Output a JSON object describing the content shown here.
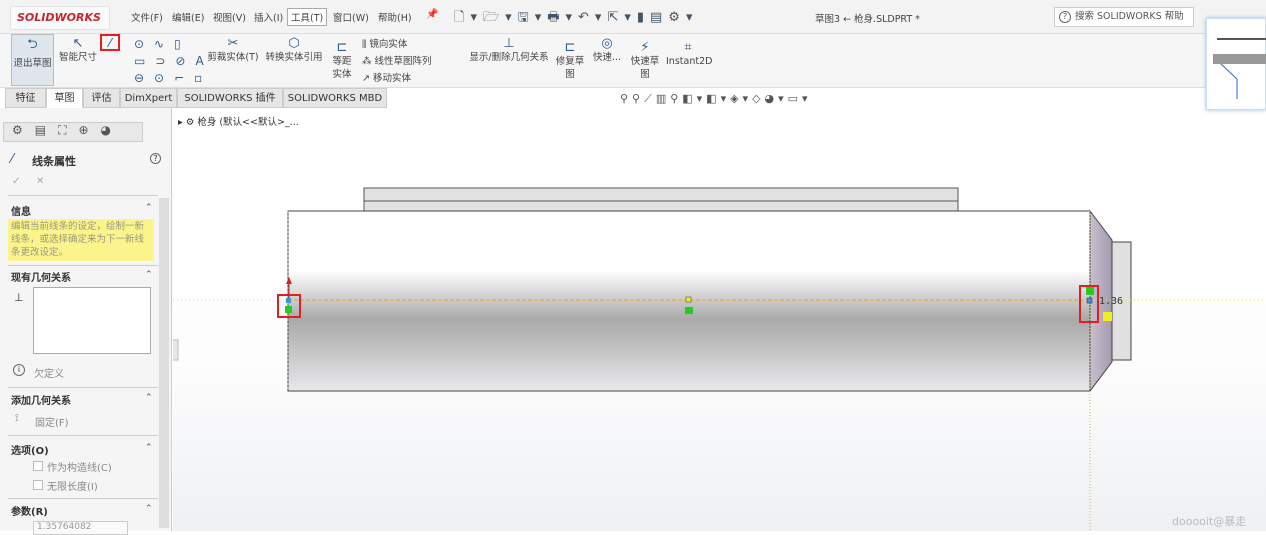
{
  "app": {
    "logo": "SOLIDWORKS",
    "doc_title": "草图3 ← 枪身.SLDPRT *",
    "help_search_placeholder": "搜索 SOLIDWORKS 帮助"
  },
  "menu": [
    "文件(F)",
    "编辑(E)",
    "视图(V)",
    "插入(I)",
    "工具(T)",
    "窗口(W)",
    "帮助(H)"
  ],
  "ribbon": {
    "exit_sketch": "退出草图",
    "smart_dim": "智能尺寸",
    "trim": "剪裁实体(T)",
    "convert": "转换实体引用",
    "offset": "等距实体",
    "mirror": "镜向实体",
    "linear_pattern": "线性草图阵列",
    "move": "移动实体",
    "show_relations": "显示/删除几何关系",
    "repair": "修复草图",
    "quick_snaps": "快速...",
    "rapid_sketch": "快速草图",
    "instant2d": "Instant2D"
  },
  "tabs": [
    "特征",
    "草图",
    "评估",
    "DimXpert",
    "SOLIDWORKS 插件",
    "SOLIDWORKS MBD"
  ],
  "active_tab": "草图",
  "tree": {
    "item": "枪身 (默认<<默认>_..."
  },
  "panel": {
    "title": "线条属性",
    "info_header": "信息",
    "info_text": "编辑当前线条的设定，绘制一新线条，或选择确定来为下一新线条更改设定。",
    "existing_header": "现有几何关系",
    "status": "欠定义",
    "add_header": "添加几何关系",
    "fix": "固定(F)",
    "options_header": "选项(O)",
    "construction": "作为构造线(C)",
    "infinite": "无限长度(I)",
    "params_header": "参数(R)",
    "param_value": "1.35764082"
  },
  "sketch": {
    "dimension": "1.36"
  },
  "watermark": "dooooit@暴走",
  "colors": {
    "accent_red": "#e02020",
    "centerline": "#f0a020",
    "info_bg": "#fbf48c"
  }
}
